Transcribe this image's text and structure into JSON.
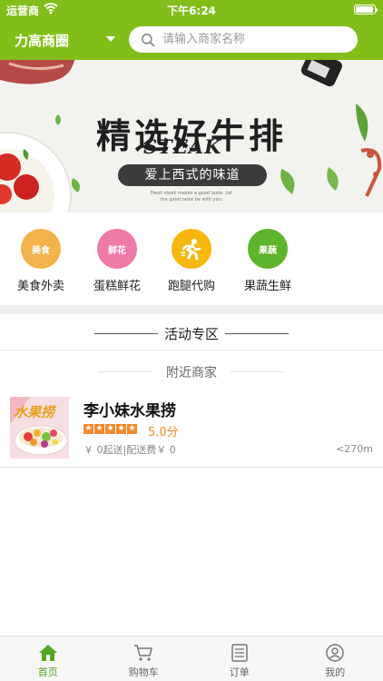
{
  "status_bar": {
    "carrier": "运营商",
    "time": "下午6:24",
    "battery_level": 0.95
  },
  "header": {
    "location_label": "力高商圈",
    "search_placeholder": "请输入商家名称",
    "accent_color": "#82be1a"
  },
  "banner": {
    "english_title": "STEAK",
    "chinese_title": "精选好牛排",
    "pill_text": "爱上西式的味道",
    "small_line_1": "Fresh steak makes a good taste. Let",
    "small_line_2": "the good taste be with you."
  },
  "categories": [
    {
      "label": "美食外卖",
      "icon": "food-delivery-icon",
      "icon_text": "美食",
      "color": "#f3b24c"
    },
    {
      "label": "蛋糕鲜花",
      "icon": "cake-flower-icon",
      "icon_text": "鲜花",
      "color": "#f07aa7"
    },
    {
      "label": "跑腿代购",
      "icon": "errand-runner-icon",
      "icon_text": "",
      "color": "#f6b80f"
    },
    {
      "label": "果蔬生鲜",
      "icon": "fruit-veg-icon",
      "icon_text": "果蔬",
      "color": "#5fb42d"
    }
  ],
  "sections": {
    "activity_title": "活动专区",
    "nearby_title": "附近商家"
  },
  "merchants": [
    {
      "name": "李小妹水果捞",
      "thumb_text": "水果捞",
      "rating": "5.0分",
      "stars": 5,
      "fees": "￥ 0起送|配送费￥ 0",
      "distance": "<270m"
    }
  ],
  "tabbar": {
    "active_color": "#55a521",
    "tabs": [
      {
        "label": "首页",
        "icon": "home-icon",
        "active": true
      },
      {
        "label": "购物车",
        "icon": "cart-icon",
        "active": false
      },
      {
        "label": "订单",
        "icon": "order-list-icon",
        "active": false
      },
      {
        "label": "我的",
        "icon": "profile-icon",
        "active": false
      }
    ]
  }
}
